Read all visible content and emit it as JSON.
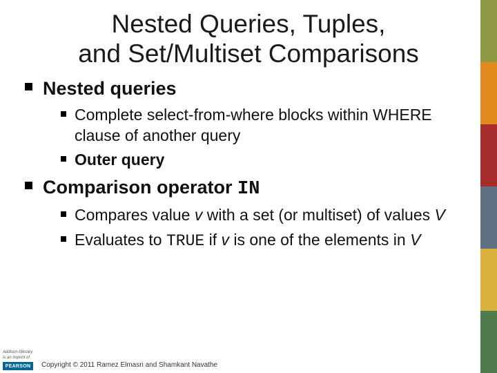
{
  "title_line1": "Nested Queries, Tuples,",
  "title_line2": "and Set/Multiset Comparisons",
  "bullets": {
    "b1": "Nested queries",
    "b1_1_a": "Complete select-from-where blocks within WHERE clause of another query",
    "b1_2": "Outer query",
    "b2_a": "Comparison operator ",
    "b2_code": "IN",
    "b2_1_a": "Compares value ",
    "b2_1_v": "v",
    "b2_1_b": " with a set (or multiset) of values ",
    "b2_1_V": "V",
    "b2_2_a": "Evaluates to ",
    "b2_2_code": "TRUE",
    "b2_2_b": " if ",
    "b2_2_v": "v",
    "b2_2_c": " is one of the elements in ",
    "b2_2_V": "V"
  },
  "footer": {
    "copyright": "Copyright © 2011 Ramez Elmasri and Shamkant Navathe",
    "brand_top1": "Addison-Wesley",
    "brand_top2": "is an imprint of",
    "brand_name": "PEARSON"
  }
}
